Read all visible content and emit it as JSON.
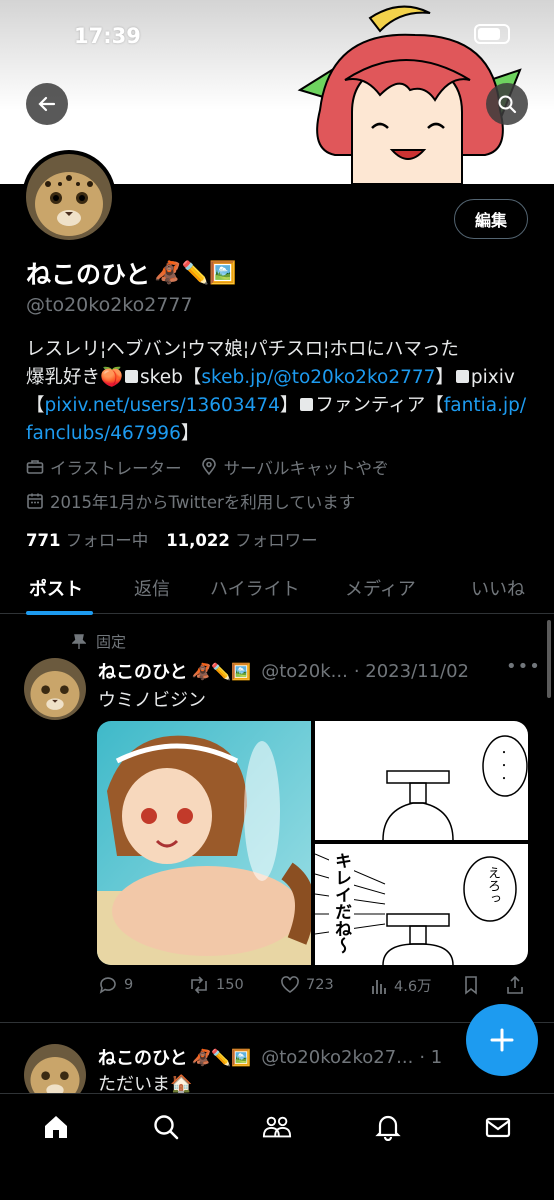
{
  "status_bar": {
    "time": "17:39"
  },
  "profile": {
    "display_name": "ねこのひと",
    "name_emoji": "🦧✏️🖼️",
    "handle": "@to20ko2ko2777",
    "edit_label": "編集",
    "bio": {
      "line1": "レスレリ¦ヘブバン¦ウマ娘¦パチスロ¦ホロにハマった",
      "line2_a": "爆乳好き🍑",
      "skeb_label": "skeb【",
      "skeb_link": "skeb.jp/@to20ko2ko2777",
      "skeb_close": "】",
      "pixiv_label": "pixiv",
      "pixiv_open": "【",
      "pixiv_link": "pixiv.net/users/13603474",
      "pixiv_close": "】",
      "fantia_label": "ファンティア【",
      "fantia_link_1": "fantia.jp/",
      "fantia_link_2": "fanclubs/467996",
      "fantia_close": "】"
    },
    "job": "イラストレーター",
    "location": "サーバルキャットやぞ",
    "joined": "2015年1月からTwitterを利用しています",
    "following_count": "771",
    "following_label": "フォロー中",
    "followers_count": "11,022",
    "followers_label": "フォロワー"
  },
  "tabs": [
    "ポスト",
    "返信",
    "ハイライト",
    "メディア",
    "いいね"
  ],
  "posts": [
    {
      "pinned_label": "固定",
      "name": "ねこのひと",
      "emoji": "🦧✏️🖼️",
      "handle": "@to20k...",
      "date": "· 2023/11/02",
      "text": "ウミノビジン",
      "replies": "9",
      "reposts": "150",
      "likes": "723",
      "views": "4.6万",
      "comic_text_1": "キレイだね〜",
      "comic_text_2": "えろっ"
    },
    {
      "name": "ねこのひと",
      "emoji": "🦧✏️🖼️",
      "handle": "@to20ko2ko27...",
      "date": "· 1",
      "text": "ただいま🏠"
    }
  ],
  "colors": {
    "accent": "#1d9bf0",
    "bg": "#000000",
    "muted": "#71767b"
  },
  "icons": [
    "back-arrow-icon",
    "search-icon",
    "briefcase-icon",
    "location-pin-icon",
    "calendar-icon",
    "pin-icon",
    "more-icon",
    "reply-icon",
    "repost-icon",
    "like-icon",
    "views-icon",
    "bookmark-icon",
    "share-icon",
    "compose-plus-icon",
    "home-icon",
    "explore-icon",
    "communities-icon",
    "notifications-icon",
    "messages-icon"
  ]
}
